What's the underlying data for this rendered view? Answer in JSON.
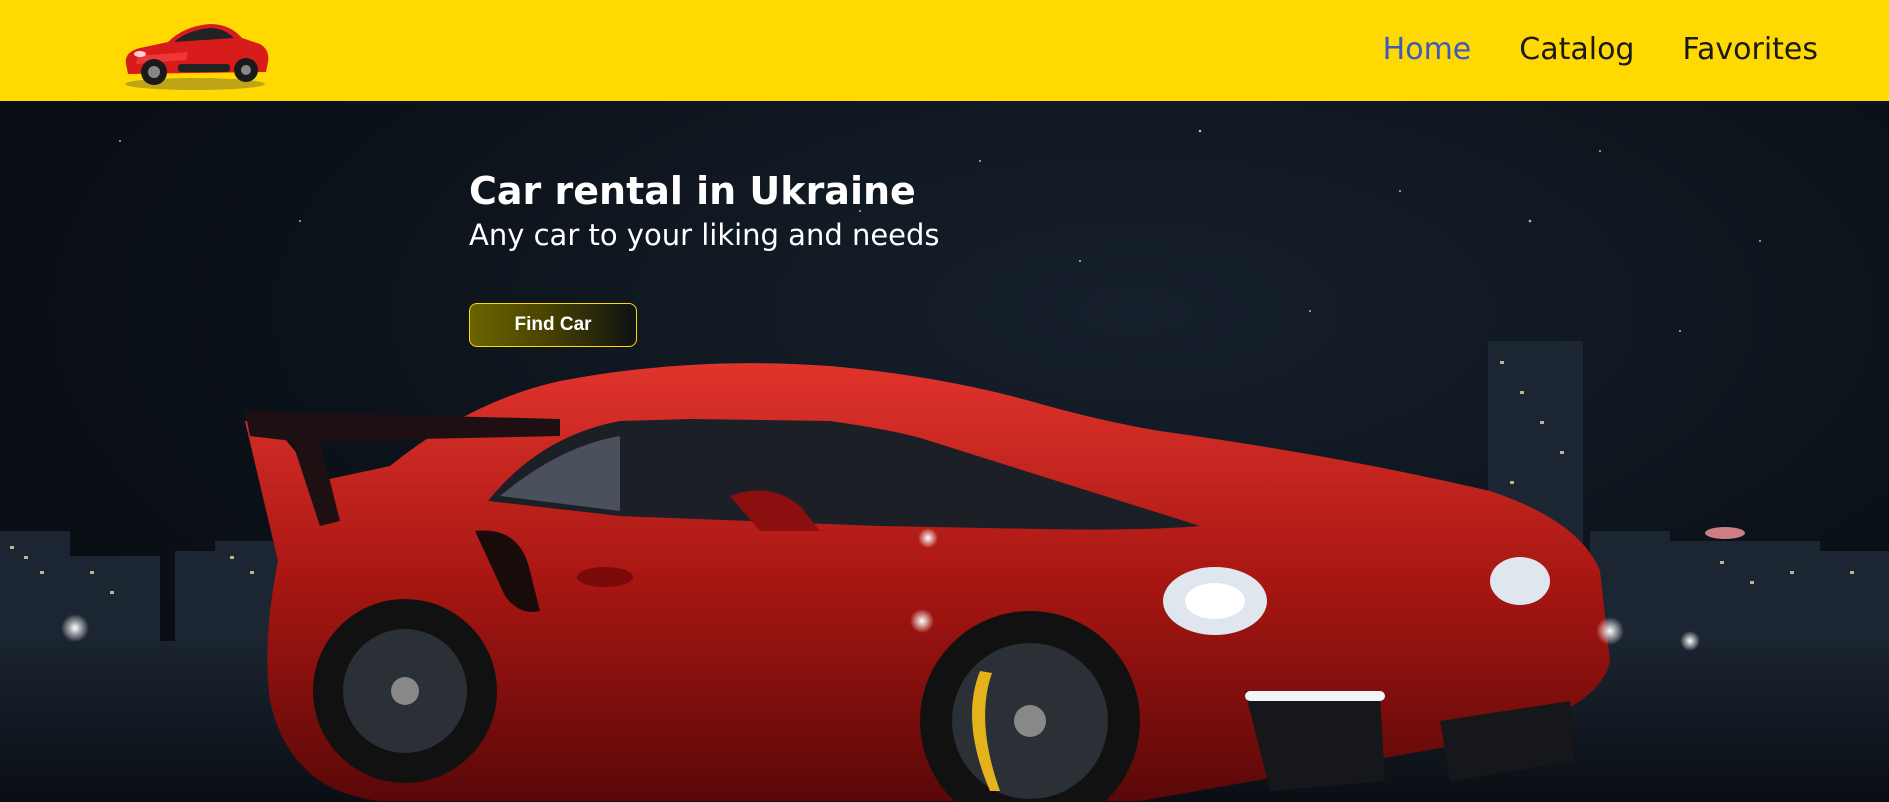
{
  "header": {
    "logo_icon": "red-sports-car-logo",
    "background_color": "#ffd900",
    "nav": [
      {
        "label": "Home",
        "active": true
      },
      {
        "label": "Catalog",
        "active": false
      },
      {
        "label": "Favorites",
        "active": false
      }
    ]
  },
  "hero": {
    "title": "Car rental in Ukraine",
    "subtitle": "Any car to your liking and needs",
    "cta_label": "Find Car",
    "background_image": "red-porsche-night-city-photo",
    "accent_color": "#ffd900"
  }
}
